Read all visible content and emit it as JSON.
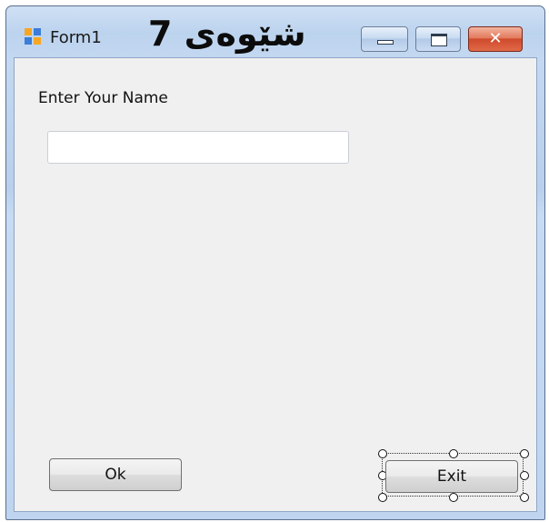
{
  "window": {
    "title": "Form1",
    "title_overlay": "شێوەی 7",
    "controls": {
      "minimize": "minimize",
      "maximize": "maximize",
      "close": "✕"
    }
  },
  "form": {
    "name_label": "Enter Your Name",
    "name_input_value": "",
    "name_input_placeholder": "",
    "ok_button": "Ok",
    "exit_button": "Exit"
  },
  "icons": {
    "app": "winforms-app-icon",
    "minimize": "minimize-icon",
    "maximize": "maximize-icon",
    "close": "close-icon"
  },
  "colors": {
    "frame": "#bcd3ee",
    "client": "#f0f0f0",
    "close_button": "#cf4a2c"
  }
}
